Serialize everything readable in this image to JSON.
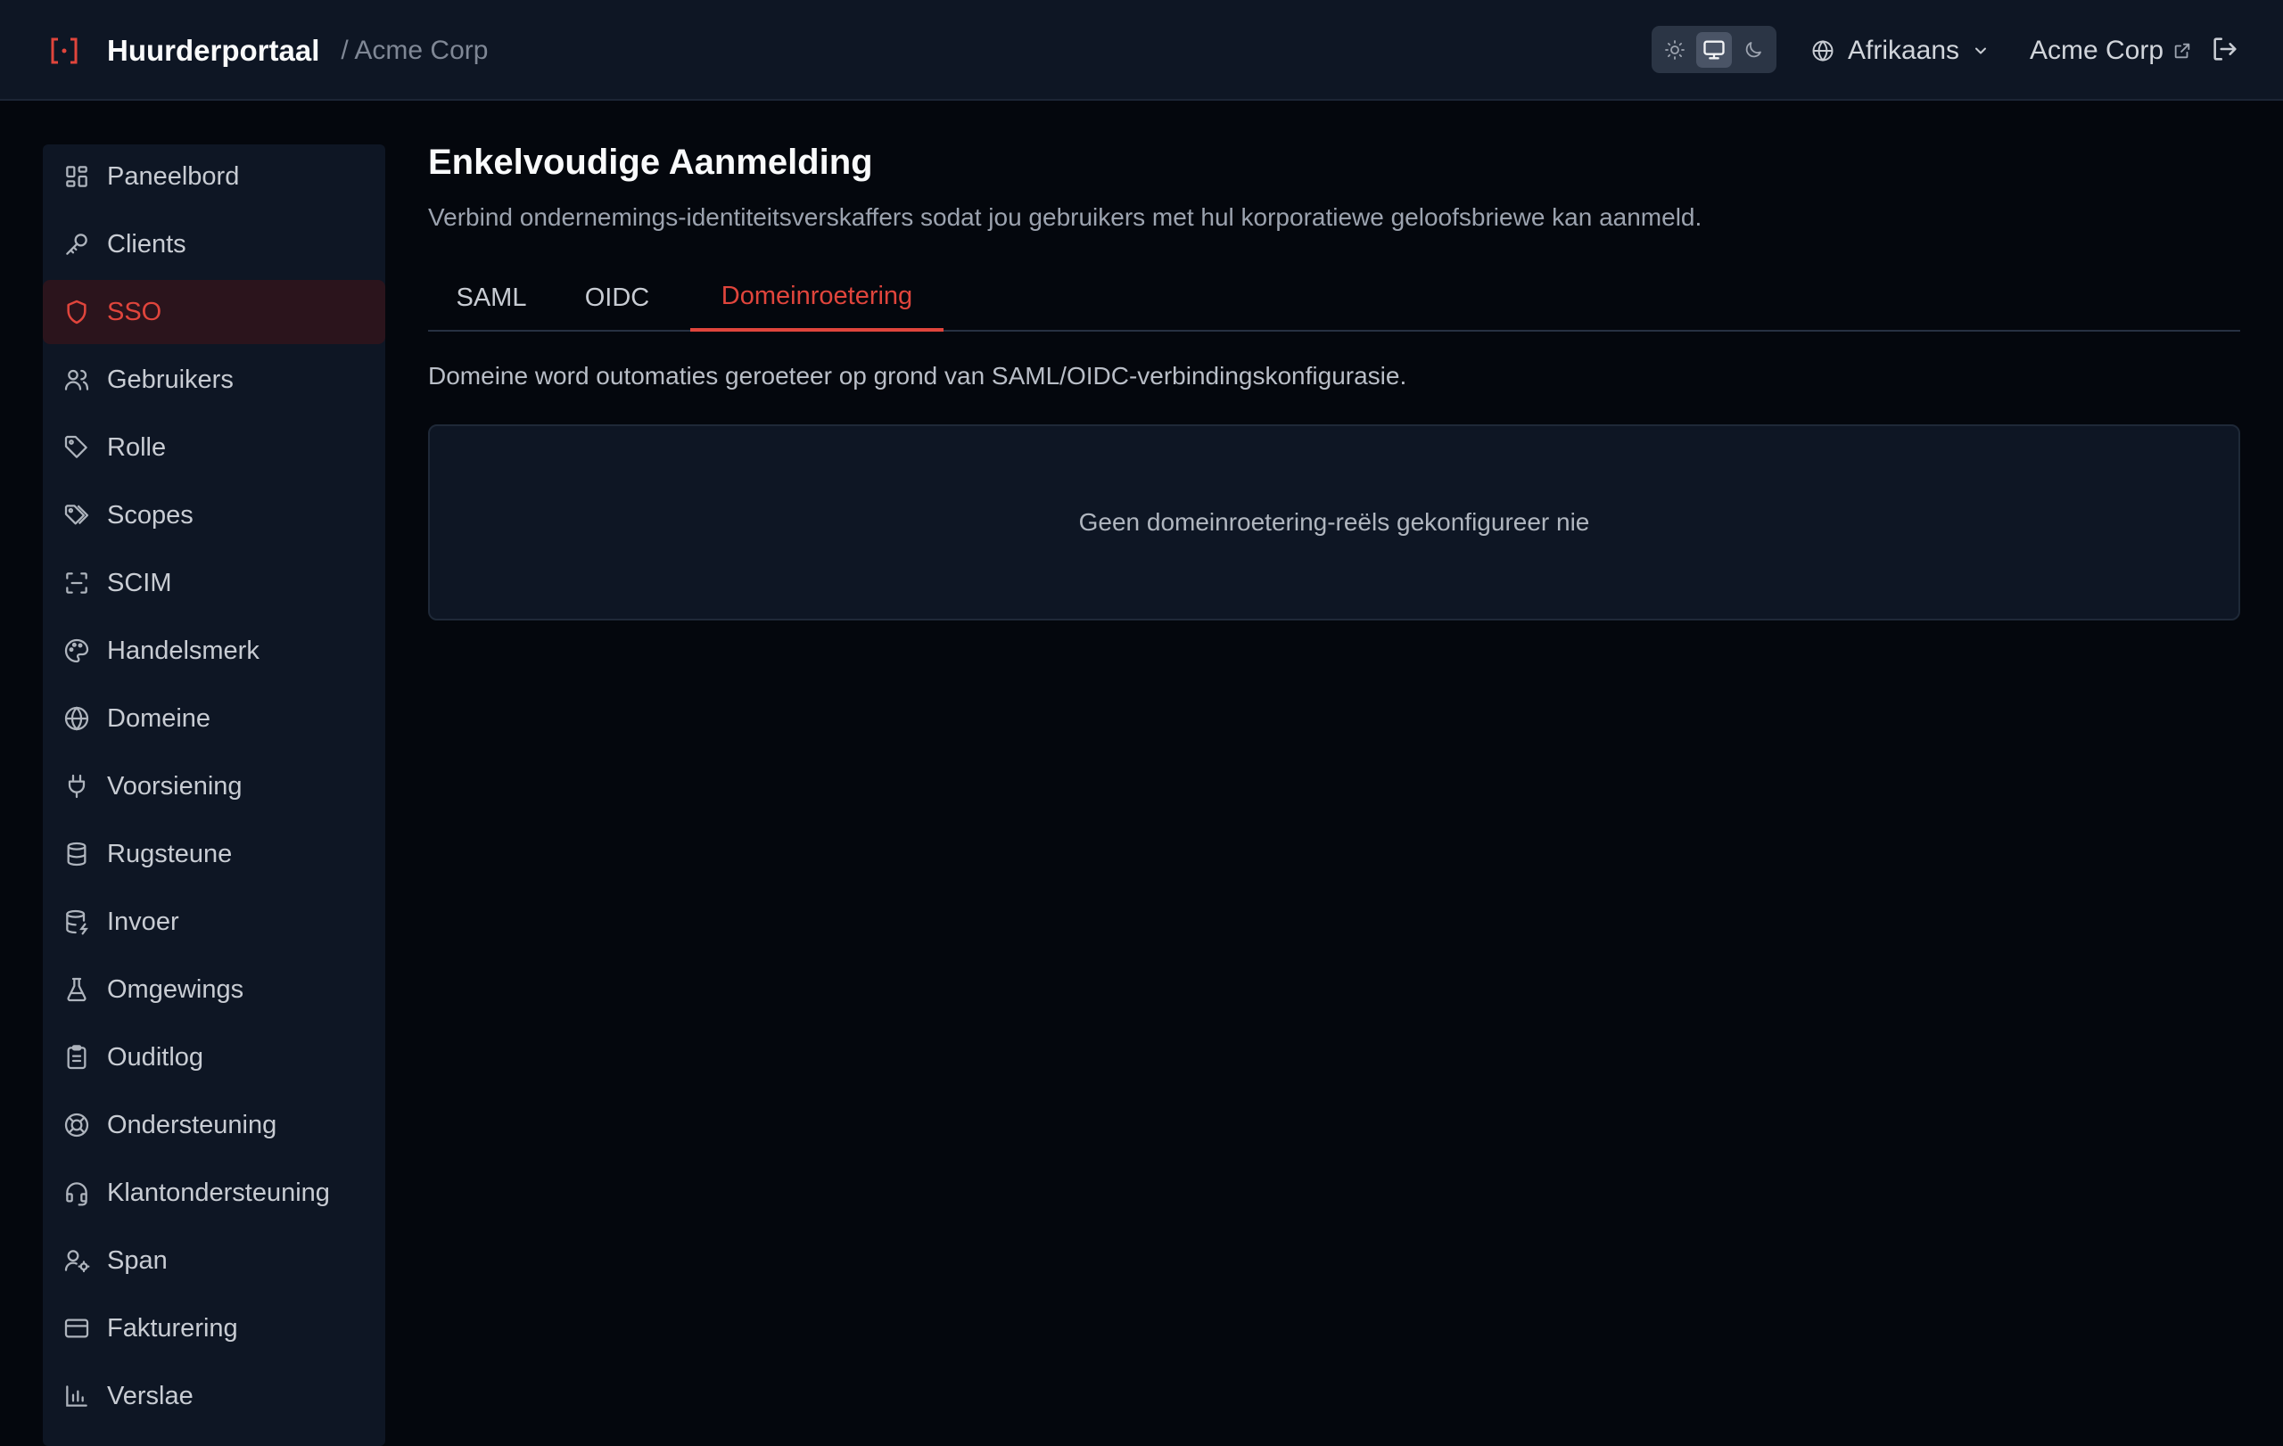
{
  "header": {
    "brand_name": "Huurderportaal",
    "breadcrumb": "/ Acme Corp",
    "language": "Afrikaans",
    "tenant_name": "Acme Corp",
    "theme_modes": [
      "light",
      "system",
      "dark"
    ],
    "active_theme": "system"
  },
  "sidebar": {
    "items": [
      {
        "label": "Paneelbord",
        "icon": "dashboard-icon"
      },
      {
        "label": "Clients",
        "icon": "key-icon"
      },
      {
        "label": "SSO",
        "icon": "shield-icon",
        "active": true
      },
      {
        "label": "Gebruikers",
        "icon": "users-icon"
      },
      {
        "label": "Rolle",
        "icon": "tag-icon"
      },
      {
        "label": "Scopes",
        "icon": "tags-icon"
      },
      {
        "label": "SCIM",
        "icon": "scan-icon"
      },
      {
        "label": "Handelsmerk",
        "icon": "palette-icon"
      },
      {
        "label": "Domeine",
        "icon": "globe-icon"
      },
      {
        "label": "Voorsiening",
        "icon": "plug-icon"
      },
      {
        "label": "Rugsteune",
        "icon": "database-icon"
      },
      {
        "label": "Invoer",
        "icon": "database-import-icon"
      },
      {
        "label": "Omgewings",
        "icon": "flask-icon"
      },
      {
        "label": "Ouditlog",
        "icon": "clipboard-icon"
      },
      {
        "label": "Ondersteuning",
        "icon": "lifebuoy-icon"
      },
      {
        "label": "Klantondersteuning",
        "icon": "headset-icon"
      },
      {
        "label": "Span",
        "icon": "user-cog-icon"
      },
      {
        "label": "Fakturering",
        "icon": "credit-card-icon"
      },
      {
        "label": "Verslae",
        "icon": "bar-chart-icon"
      }
    ]
  },
  "main": {
    "title": "Enkelvoudige Aanmelding",
    "subtitle": "Verbind ondernemings-identiteitsverskaffers sodat jou gebruikers met hul korporatiewe geloofsbriewe kan aanmeld.",
    "tabs": [
      {
        "label": "SAML"
      },
      {
        "label": "OIDC"
      },
      {
        "label": "Domeinroetering",
        "active": true
      }
    ],
    "info_text": "Domeine word outomaties geroeteer op grond van SAML/OIDC-verbindingskonfigurasie.",
    "empty_message": "Geen domeinroetering-reëls gekonfigureer nie"
  },
  "colors": {
    "accent": "#e0453c",
    "background": "#04070d",
    "panel": "#0e1624"
  }
}
